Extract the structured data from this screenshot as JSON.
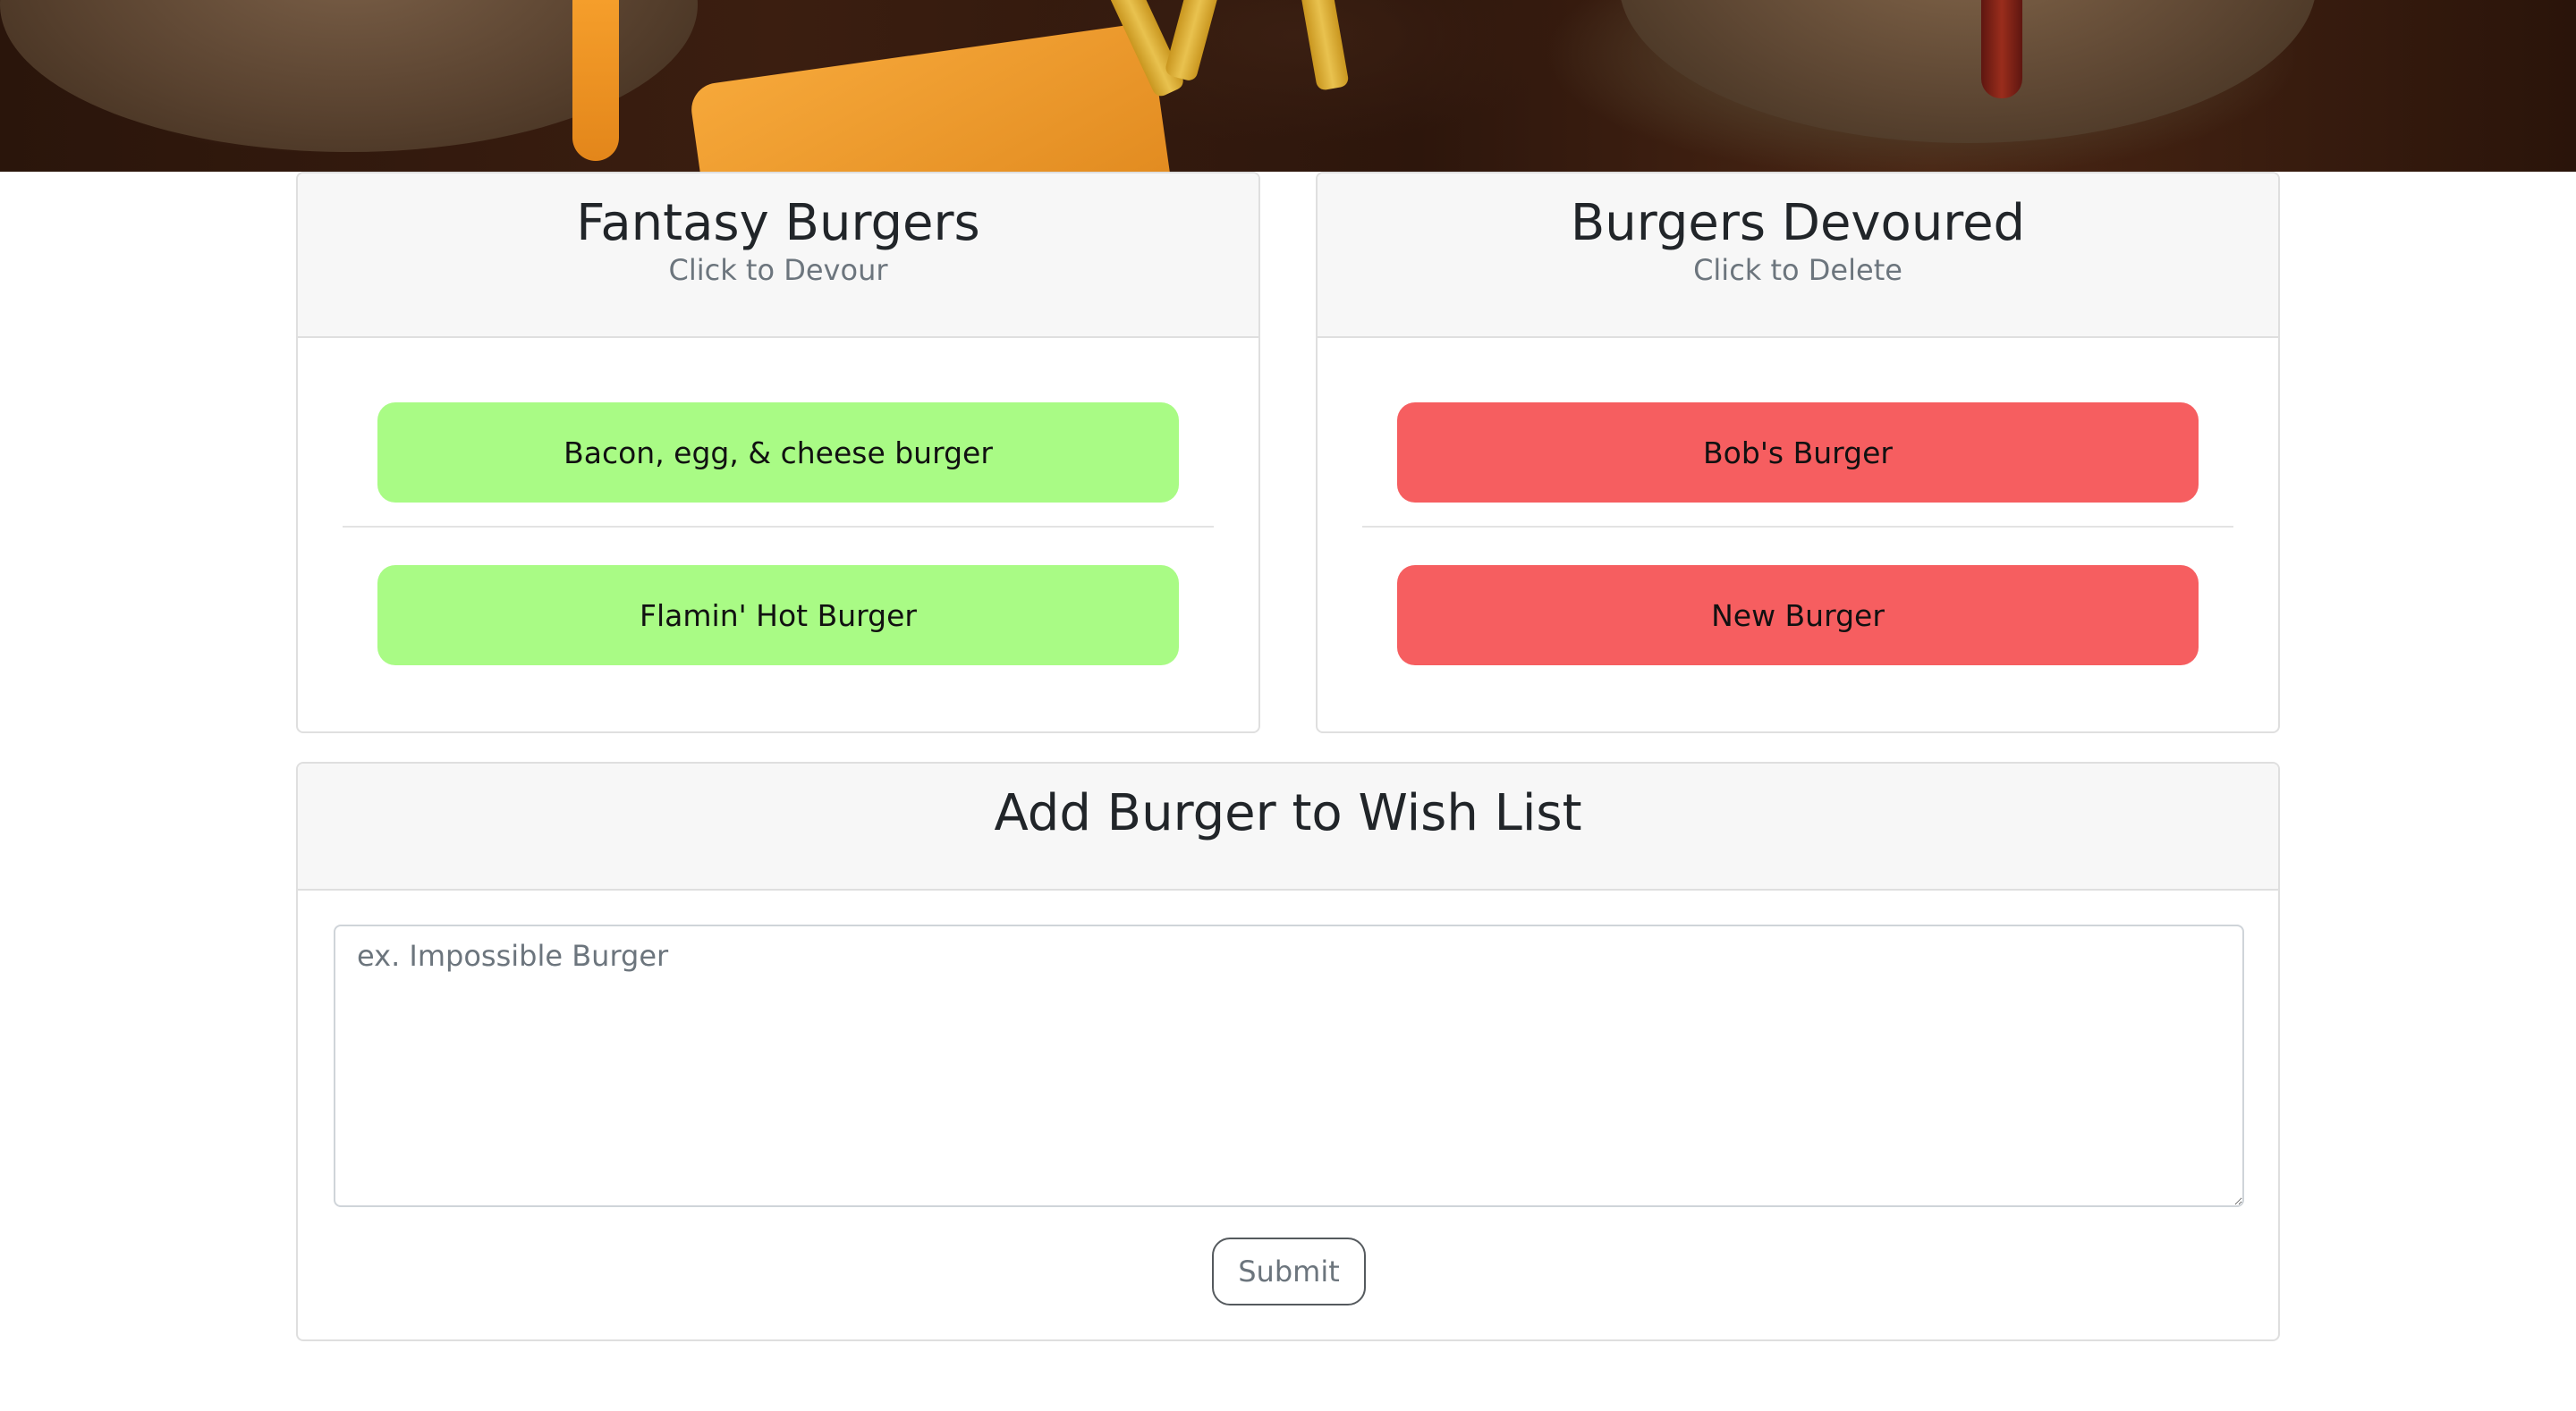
{
  "hero": {
    "image_name": "burger-banner-image"
  },
  "fantasy": {
    "title": "Fantasy Burgers",
    "subtitle": "Click to Devour",
    "items": [
      {
        "label": "Bacon, egg, & cheese burger"
      },
      {
        "label": "Flamin' Hot Burger"
      }
    ],
    "button_color": "#a9fb85"
  },
  "devoured": {
    "title": "Burgers Devoured",
    "subtitle": "Click to Delete",
    "items": [
      {
        "label": "Bob's Burger"
      },
      {
        "label": "New Burger"
      }
    ],
    "button_color": "#f65e60"
  },
  "wish": {
    "title": "Add Burger to Wish List",
    "placeholder": "ex. Impossible Burger",
    "value": "",
    "submit_label": "Submit"
  }
}
